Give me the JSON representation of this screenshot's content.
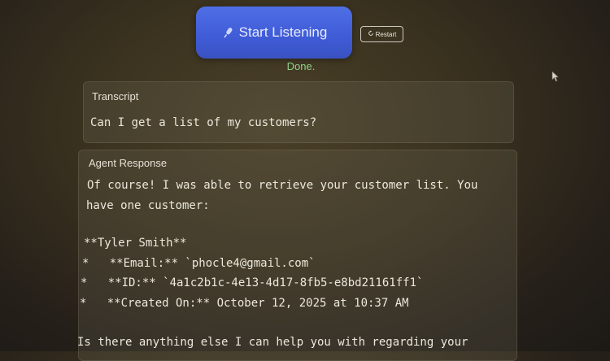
{
  "controls": {
    "start_label": "Start Listening",
    "restart_label": "Restart",
    "status_text": "Done."
  },
  "transcript": {
    "title": "Transcript",
    "text": "Can I get a list of my customers?"
  },
  "agent_response": {
    "title": "Agent Response",
    "lines": [
      "Of course! I was able to retrieve your customer list. You",
      "have one customer:",
      "",
      "**Tyler Smith**",
      "*   **Email:** `phocle4@gmail.com`",
      "*   **ID:** `4a1c2b1c-4e13-4d17-8fb5-e8bd21161ff1`",
      "*   **Created On:** October 12, 2025 at 10:37 AM",
      "",
      "Is there anything else I can help you with regarding your"
    ]
  },
  "icons": {
    "start": "microphone-icon",
    "restart": "refresh-icon",
    "pointer": "mouse-cursor-icon"
  },
  "colors": {
    "start_button": "#4562dc",
    "status_text": "#8fd08a",
    "background": "#3a321f"
  }
}
